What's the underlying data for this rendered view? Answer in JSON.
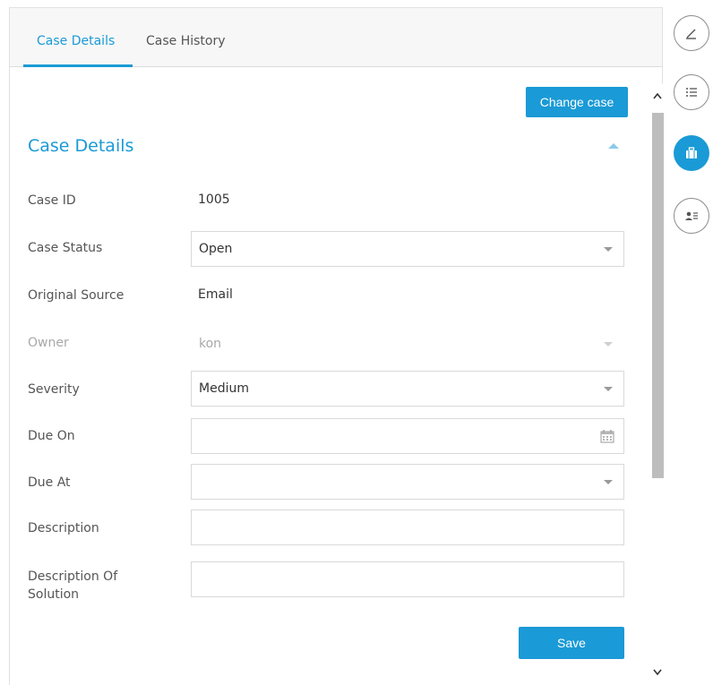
{
  "tabs": [
    {
      "label": "Case Details",
      "active": true
    },
    {
      "label": "Case History",
      "active": false
    }
  ],
  "toolbar": {
    "change_case_label": "Change case"
  },
  "section": {
    "title": "Case Details"
  },
  "fields": {
    "case_id": {
      "label": "Case ID",
      "value": "1005"
    },
    "case_status": {
      "label": "Case Status",
      "value": "Open"
    },
    "original_source": {
      "label": "Original Source",
      "value": "Email"
    },
    "owner": {
      "label": "Owner",
      "value": "kon"
    },
    "severity": {
      "label": "Severity",
      "value": "Medium"
    },
    "due_on": {
      "label": "Due On",
      "value": ""
    },
    "due_at": {
      "label": "Due At",
      "value": ""
    },
    "description": {
      "label": "Description",
      "value": ""
    },
    "description_solution": {
      "label": "Description Of Solution",
      "value": ""
    }
  },
  "actions": {
    "save_label": "Save"
  },
  "rail": {
    "items": [
      {
        "icon": "pencil-icon",
        "active": false
      },
      {
        "icon": "list-icon",
        "active": false
      },
      {
        "icon": "briefcase-icon",
        "active": true
      },
      {
        "icon": "contact-card-icon",
        "active": false
      }
    ]
  },
  "colors": {
    "accent": "#1a9ad6",
    "border": "#d9d9d9",
    "muted": "#a8a8a8"
  }
}
